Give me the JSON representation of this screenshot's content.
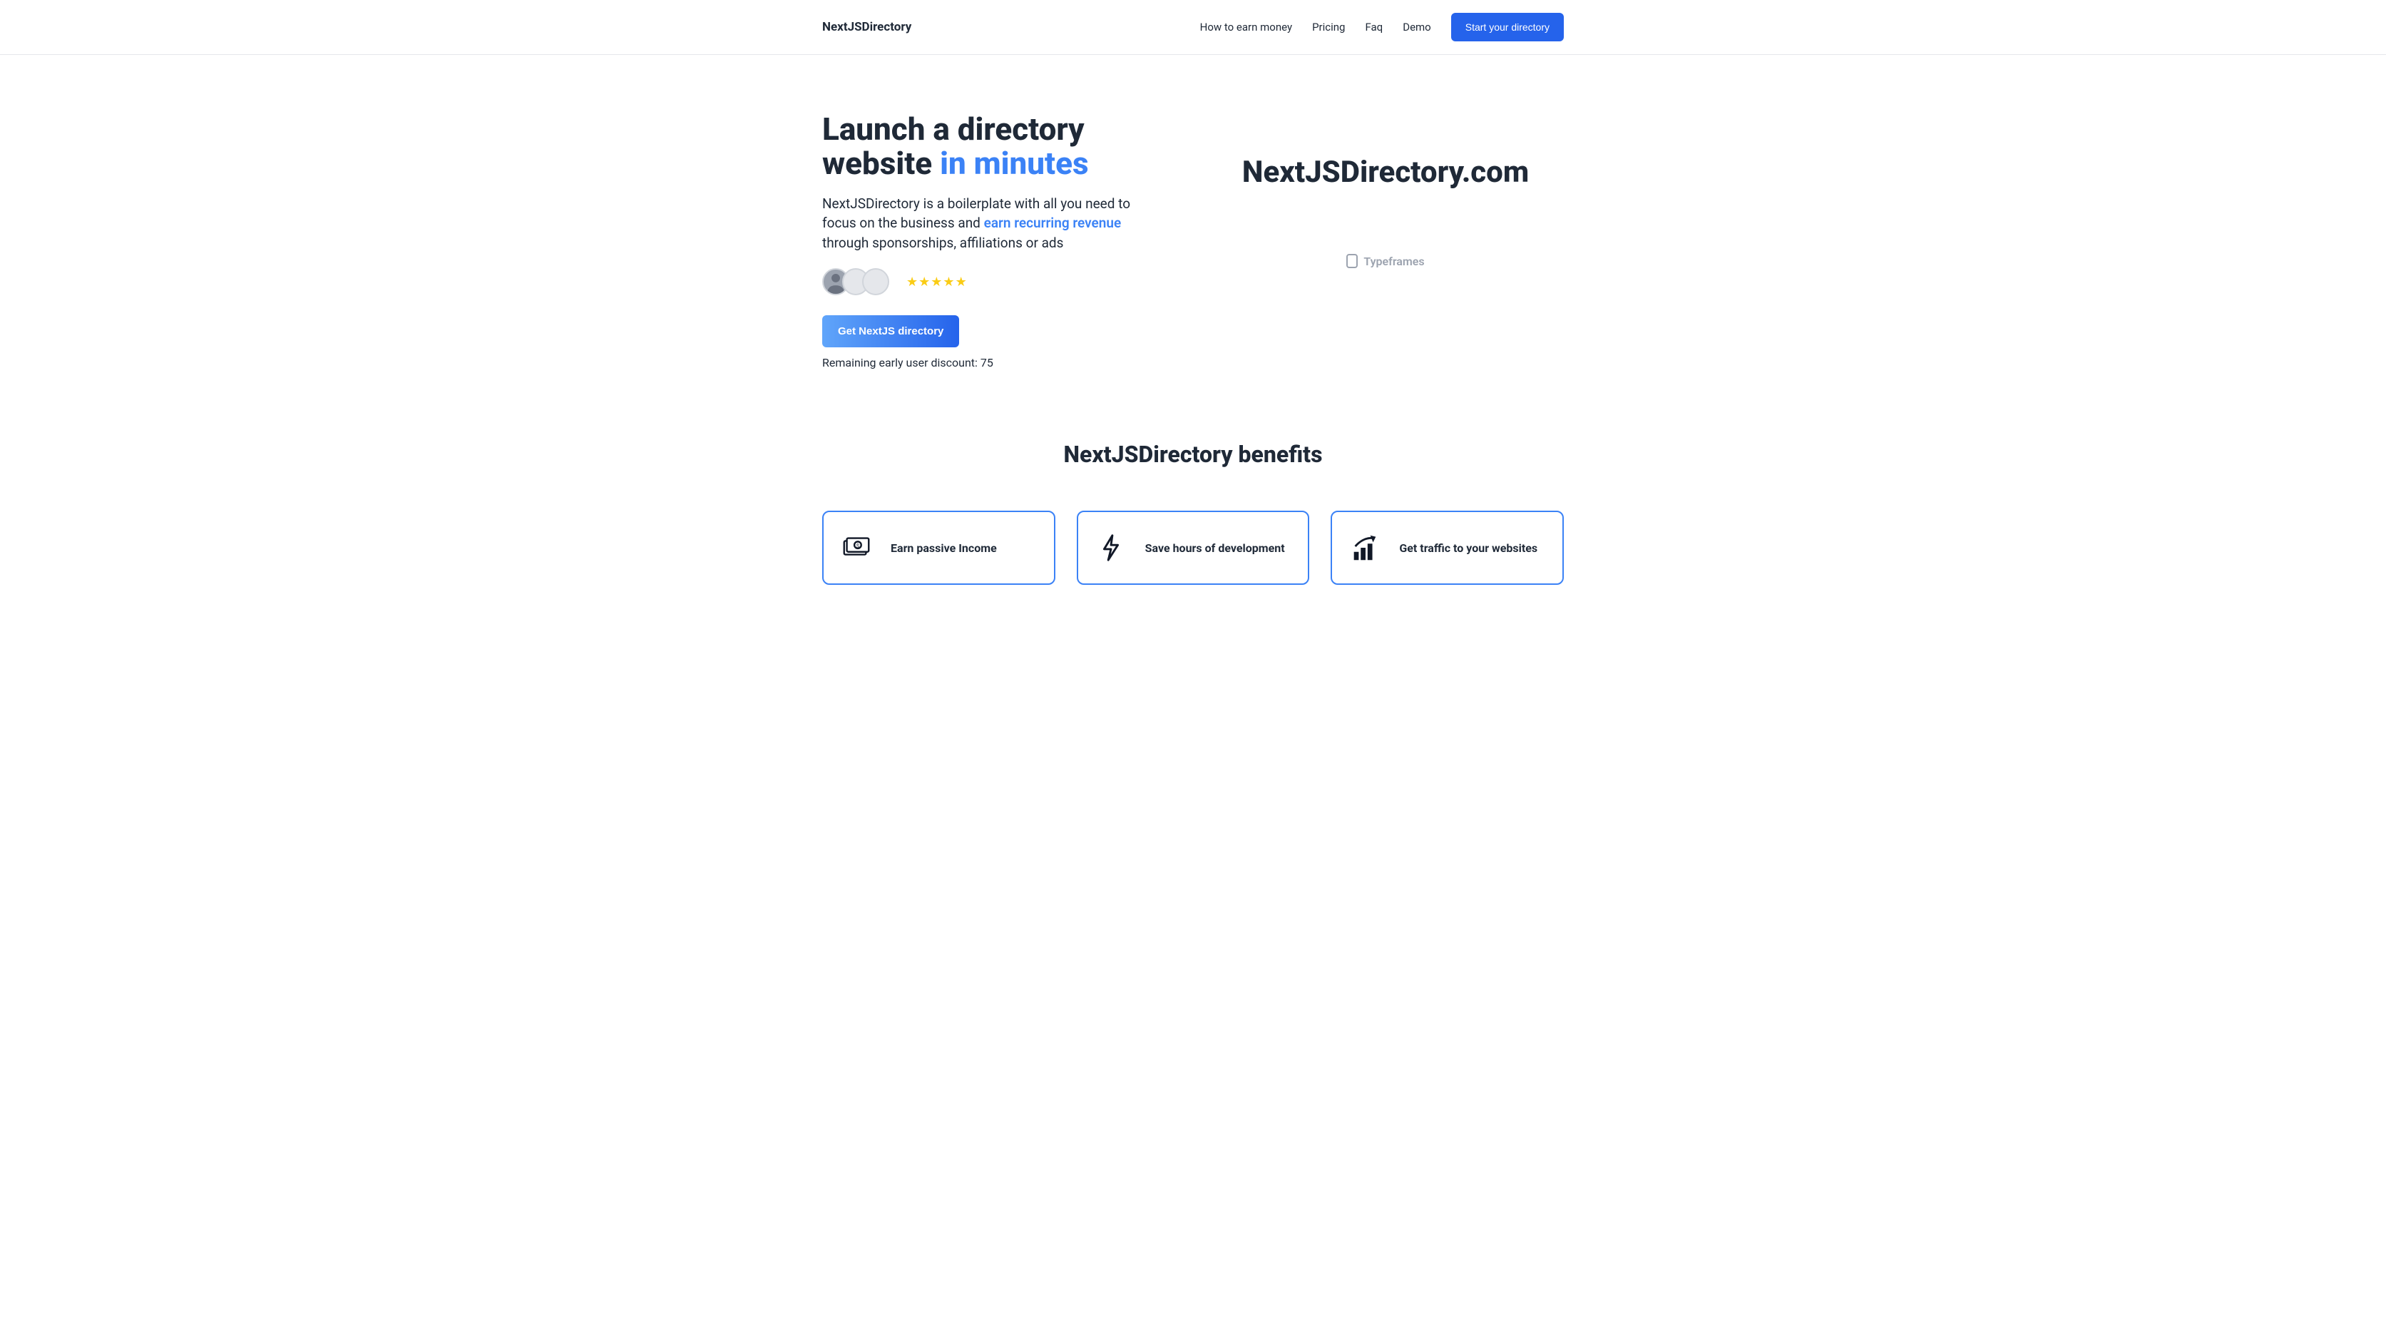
{
  "header": {
    "logo": "NextJSDirectory",
    "nav": {
      "item0": "How to earn money",
      "item1": "Pricing",
      "item2": "Faq",
      "item3": "Demo"
    },
    "cta": "Start your directory"
  },
  "hero": {
    "title_line1": "Launch a directory website ",
    "title_highlight": "in minutes",
    "sub_part1": "NextJSDirectory is a boilerplate with all you need to focus on the business and ",
    "sub_emph": "earn recurring revenue",
    "sub_part2": " through sponsorships, affiliations or ads",
    "get_button": "Get NextJS directory",
    "discount_label": "Remaining early user discount: ",
    "discount_value": "75",
    "brand_large": "NextJSDirectory.com",
    "typeframes": "Typeframes"
  },
  "benefits": {
    "heading": "NextJSDirectory benefits",
    "cards": {
      "c0": "Earn passive Income",
      "c1": "Save hours of development",
      "c2": "Get traffic to your websites"
    }
  }
}
